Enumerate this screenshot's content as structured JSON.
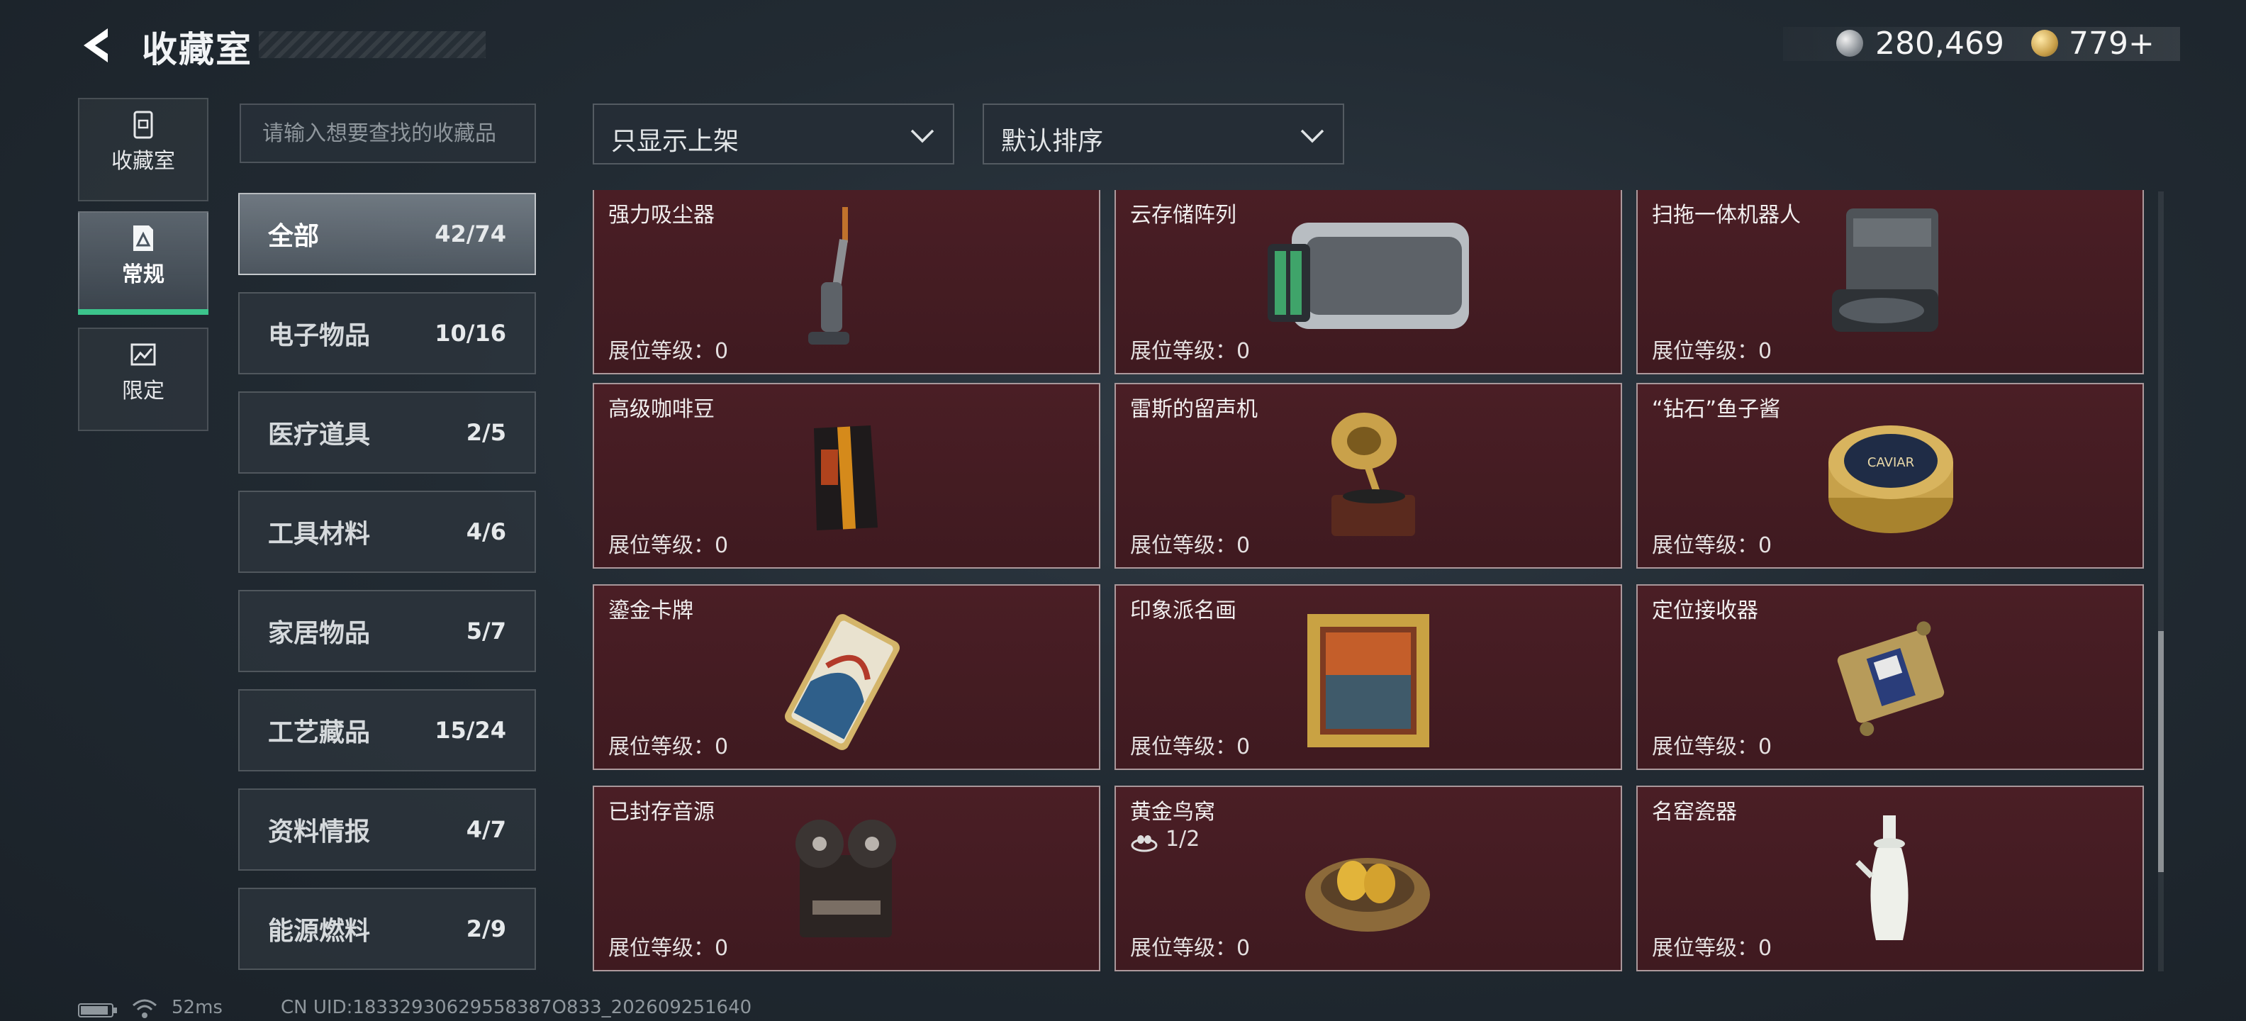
{
  "header": {
    "title": "收藏室",
    "currency_silver": "280,469",
    "currency_gold": "779+"
  },
  "nav": [
    {
      "label": "收藏室",
      "icon": "collection-room-icon"
    },
    {
      "label": "常规",
      "icon": "regular-icon"
    },
    {
      "label": "限定",
      "icon": "limited-icon"
    }
  ],
  "search": {
    "placeholder": "请输入想要查找的收藏品"
  },
  "filters": {
    "show_filter": "只显示上架",
    "sort": "默认排序"
  },
  "categories": [
    {
      "label": "全部",
      "count": "42/74"
    },
    {
      "label": "电子物品",
      "count": "10/16"
    },
    {
      "label": "医疗道具",
      "count": "2/5"
    },
    {
      "label": "工具材料",
      "count": "4/6"
    },
    {
      "label": "家居物品",
      "count": "5/7"
    },
    {
      "label": "工艺藏品",
      "count": "15/24"
    },
    {
      "label": "资料情报",
      "count": "4/7"
    },
    {
      "label": "能源燃料",
      "count": "2/9"
    }
  ],
  "items": [
    {
      "name": "强力吸尘器",
      "level": "展位等级：0"
    },
    {
      "name": "云存储阵列",
      "level": "展位等级：0"
    },
    {
      "name": "扫拖一体机器人",
      "level": "展位等级：0"
    },
    {
      "name": "高级咖啡豆",
      "level": "展位等级：0"
    },
    {
      "name": "雷斯的留声机",
      "level": "展位等级：0"
    },
    {
      "name": "“钻石”鱼子酱",
      "level": "展位等级：0",
      "art_text": "CAVIAR"
    },
    {
      "name": "鎏金卡牌",
      "level": "展位等级：0"
    },
    {
      "name": "印象派名画",
      "level": "展位等级：0"
    },
    {
      "name": "定位接收器",
      "level": "展位等级：0"
    },
    {
      "name": "已封存音源",
      "level": "展位等级：0"
    },
    {
      "name": "黄金鸟窝",
      "level": "展位等级：0",
      "sub": "1/2"
    },
    {
      "name": "名窑瓷器",
      "level": "展位等级：0"
    }
  ],
  "status": {
    "ping": "52ms",
    "uid": "CN UID:18332930629558387O833_202609251640"
  },
  "colors": {
    "card_bg": "#4a1e25",
    "accent_green": "#3cc48c"
  }
}
